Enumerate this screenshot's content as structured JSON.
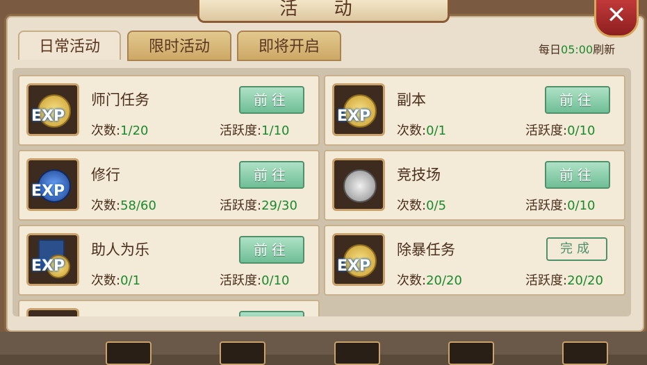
{
  "window": {
    "title": "活 动",
    "close_icon": "close-icon"
  },
  "tabs": [
    {
      "label": "日常活动",
      "active": true
    },
    {
      "label": "限时活动",
      "active": false
    },
    {
      "label": "即将开启",
      "active": false
    }
  ],
  "refresh": {
    "prefix": "每日",
    "time": "05:00",
    "suffix": "刷新"
  },
  "activities": [
    {
      "name": "师门任务",
      "count_label": "次数:",
      "count": "1/20",
      "active_label": "活跃度:",
      "active": "1/10",
      "button": "前往",
      "icon": "exp-coin-icon"
    },
    {
      "name": "副本",
      "count_label": "次数:",
      "count": "0/1",
      "active_label": "活跃度:",
      "active": "0/10",
      "button": "前往",
      "icon": "exp-yin-yang-icon"
    },
    {
      "name": "修行",
      "count_label": "次数:",
      "count": "58/60",
      "active_label": "活跃度:",
      "active": "29/30",
      "button": "前往",
      "icon": "exp-orb-icon"
    },
    {
      "name": "竞技场",
      "count_label": "次数:",
      "count": "0/5",
      "active_label": "活跃度:",
      "active": "0/10",
      "button": "前往",
      "icon": "crossed-swords-icon"
    },
    {
      "name": "助人为乐",
      "count_label": "次数:",
      "count": "0/1",
      "active_label": "活跃度:",
      "active": "0/10",
      "button": "前往",
      "icon": "exp-book-icon"
    },
    {
      "name": "除暴任务",
      "count_label": "次数:",
      "count": "20/20",
      "active_label": "活跃度:",
      "active": "20/20",
      "button": "完成",
      "icon": "exp-yin-yang-icon"
    }
  ],
  "colors": {
    "accent_green": "#1a8a2c",
    "button_green": "#6fbe96",
    "brown_text": "#4a2f1c"
  }
}
